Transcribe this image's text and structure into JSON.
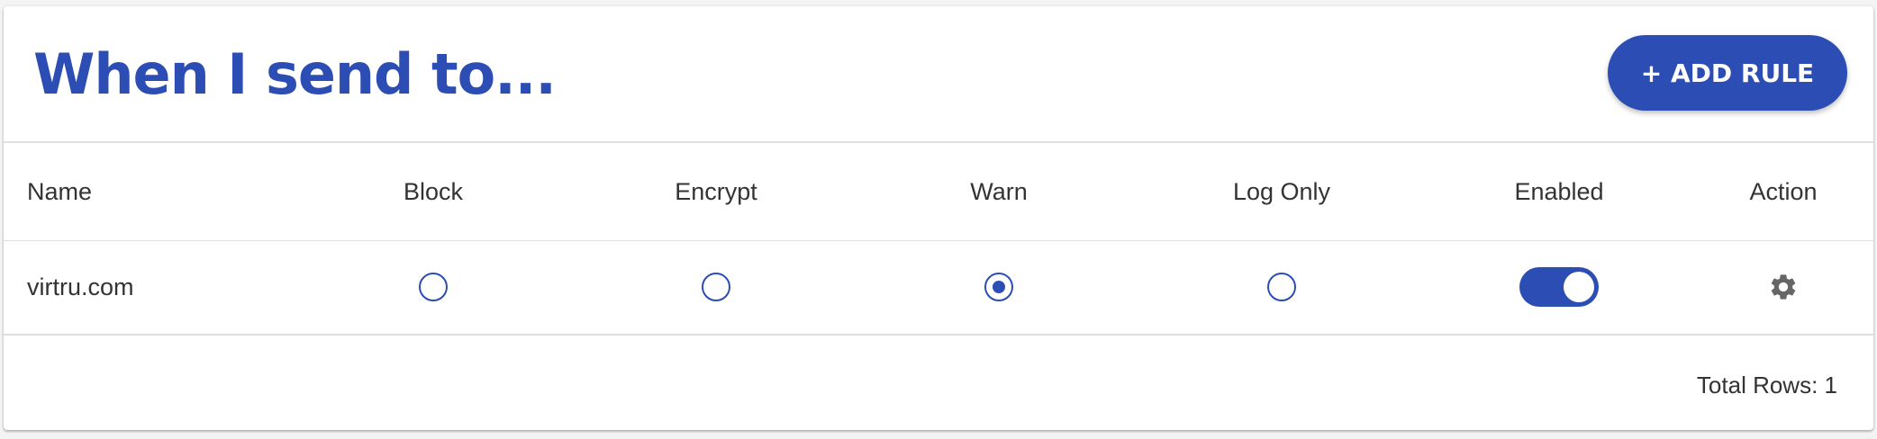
{
  "header": {
    "title": "When I send to...",
    "add_rule_label": "+ ADD RULE"
  },
  "table": {
    "columns": [
      "Name",
      "Block",
      "Encrypt",
      "Warn",
      "Log Only",
      "Enabled",
      "Action"
    ],
    "rows": [
      {
        "name": "virtru.com",
        "selected_mode": "Warn",
        "enabled": true,
        "action_icon": "gear-icon"
      }
    ]
  },
  "footer": {
    "total_rows": "Total Rows: 1"
  },
  "colors": {
    "accent": "#2b4db4",
    "text": "#333333",
    "divider": "#e0e0e0",
    "action_icon": "#666666"
  }
}
